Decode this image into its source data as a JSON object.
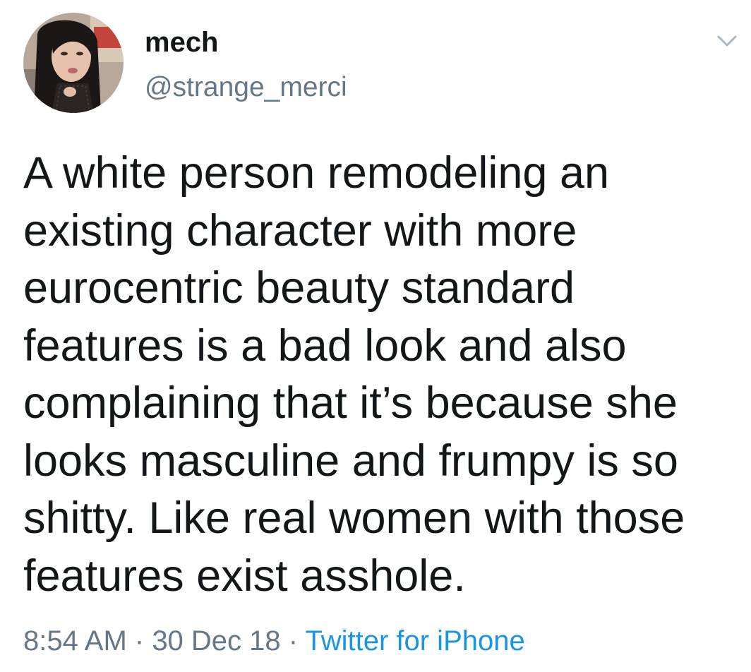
{
  "user": {
    "display_name": "mech",
    "handle": "@strange_merci"
  },
  "tweet": {
    "text_lines": [
      "A white person remodeling an",
      "existing character with more",
      "eurocentric beauty standard",
      "features is a bad look and also",
      "complaining that it’s because she",
      "looks masculine and frumpy is so",
      "shitty. Like real women with those",
      "features exist asshole."
    ]
  },
  "meta": {
    "time": "8:54 AM",
    "separator": " · ",
    "date": "30 Dec 18",
    "source": "Twitter for iPhone"
  },
  "icons": {
    "menu": "chevron-down-icon",
    "avatar": "avatar"
  },
  "colors": {
    "text": "#14171a",
    "secondary": "#657786",
    "link": "#1b95e0",
    "background": "#ffffff"
  }
}
